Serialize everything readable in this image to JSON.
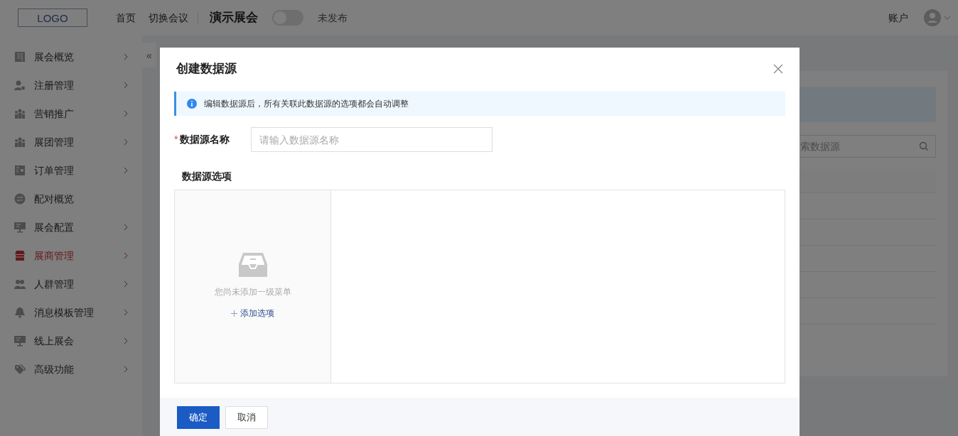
{
  "header": {
    "logo": "LOGO",
    "nav": [
      "首页",
      "切换会议"
    ],
    "event_title": "演示展会",
    "publish_switch": {
      "on": false,
      "label": "未发布"
    },
    "account": "账户"
  },
  "sidebar": {
    "collapse": "«",
    "items": [
      {
        "label": "展会概览",
        "kind": "book",
        "expandable": true,
        "selected": false
      },
      {
        "label": "注册管理",
        "kind": "user-add",
        "expandable": true,
        "selected": false
      },
      {
        "label": "营销推广",
        "kind": "group",
        "expandable": true,
        "selected": false
      },
      {
        "label": "展团管理",
        "kind": "group",
        "expandable": true,
        "selected": false
      },
      {
        "label": "订单管理",
        "kind": "order",
        "expandable": true,
        "selected": false
      },
      {
        "label": "配对概览",
        "kind": "swap",
        "expandable": false,
        "selected": false
      },
      {
        "label": "展会配置",
        "kind": "monitor",
        "expandable": true,
        "selected": false
      },
      {
        "label": "展商管理",
        "kind": "store",
        "expandable": true,
        "selected": true
      },
      {
        "label": "人群管理",
        "kind": "people",
        "expandable": true,
        "selected": false
      },
      {
        "label": "消息模板管理",
        "kind": "bell",
        "expandable": true,
        "selected": false
      },
      {
        "label": "线上展会",
        "kind": "monitor",
        "expandable": true,
        "selected": false
      },
      {
        "label": "高级功能",
        "kind": "tag",
        "expandable": true,
        "selected": false
      }
    ]
  },
  "content": {
    "search": {
      "placeholder": "索数据源"
    }
  },
  "dialog": {
    "title": "创建数据源",
    "notice": "编辑数据源后，所有关联此数据源的选项都会自动调整",
    "name_field": {
      "label": "数据源名称",
      "required": true,
      "required_mark": "*",
      "placeholder": "请输入数据源名称"
    },
    "options_label": "数据源选项",
    "empty_text": "您尚未添加一级菜单",
    "add_option": "添加选项",
    "buttons": [
      {
        "label": "确定",
        "kind": "primary"
      },
      {
        "label": "取消",
        "kind": "default"
      }
    ]
  }
}
